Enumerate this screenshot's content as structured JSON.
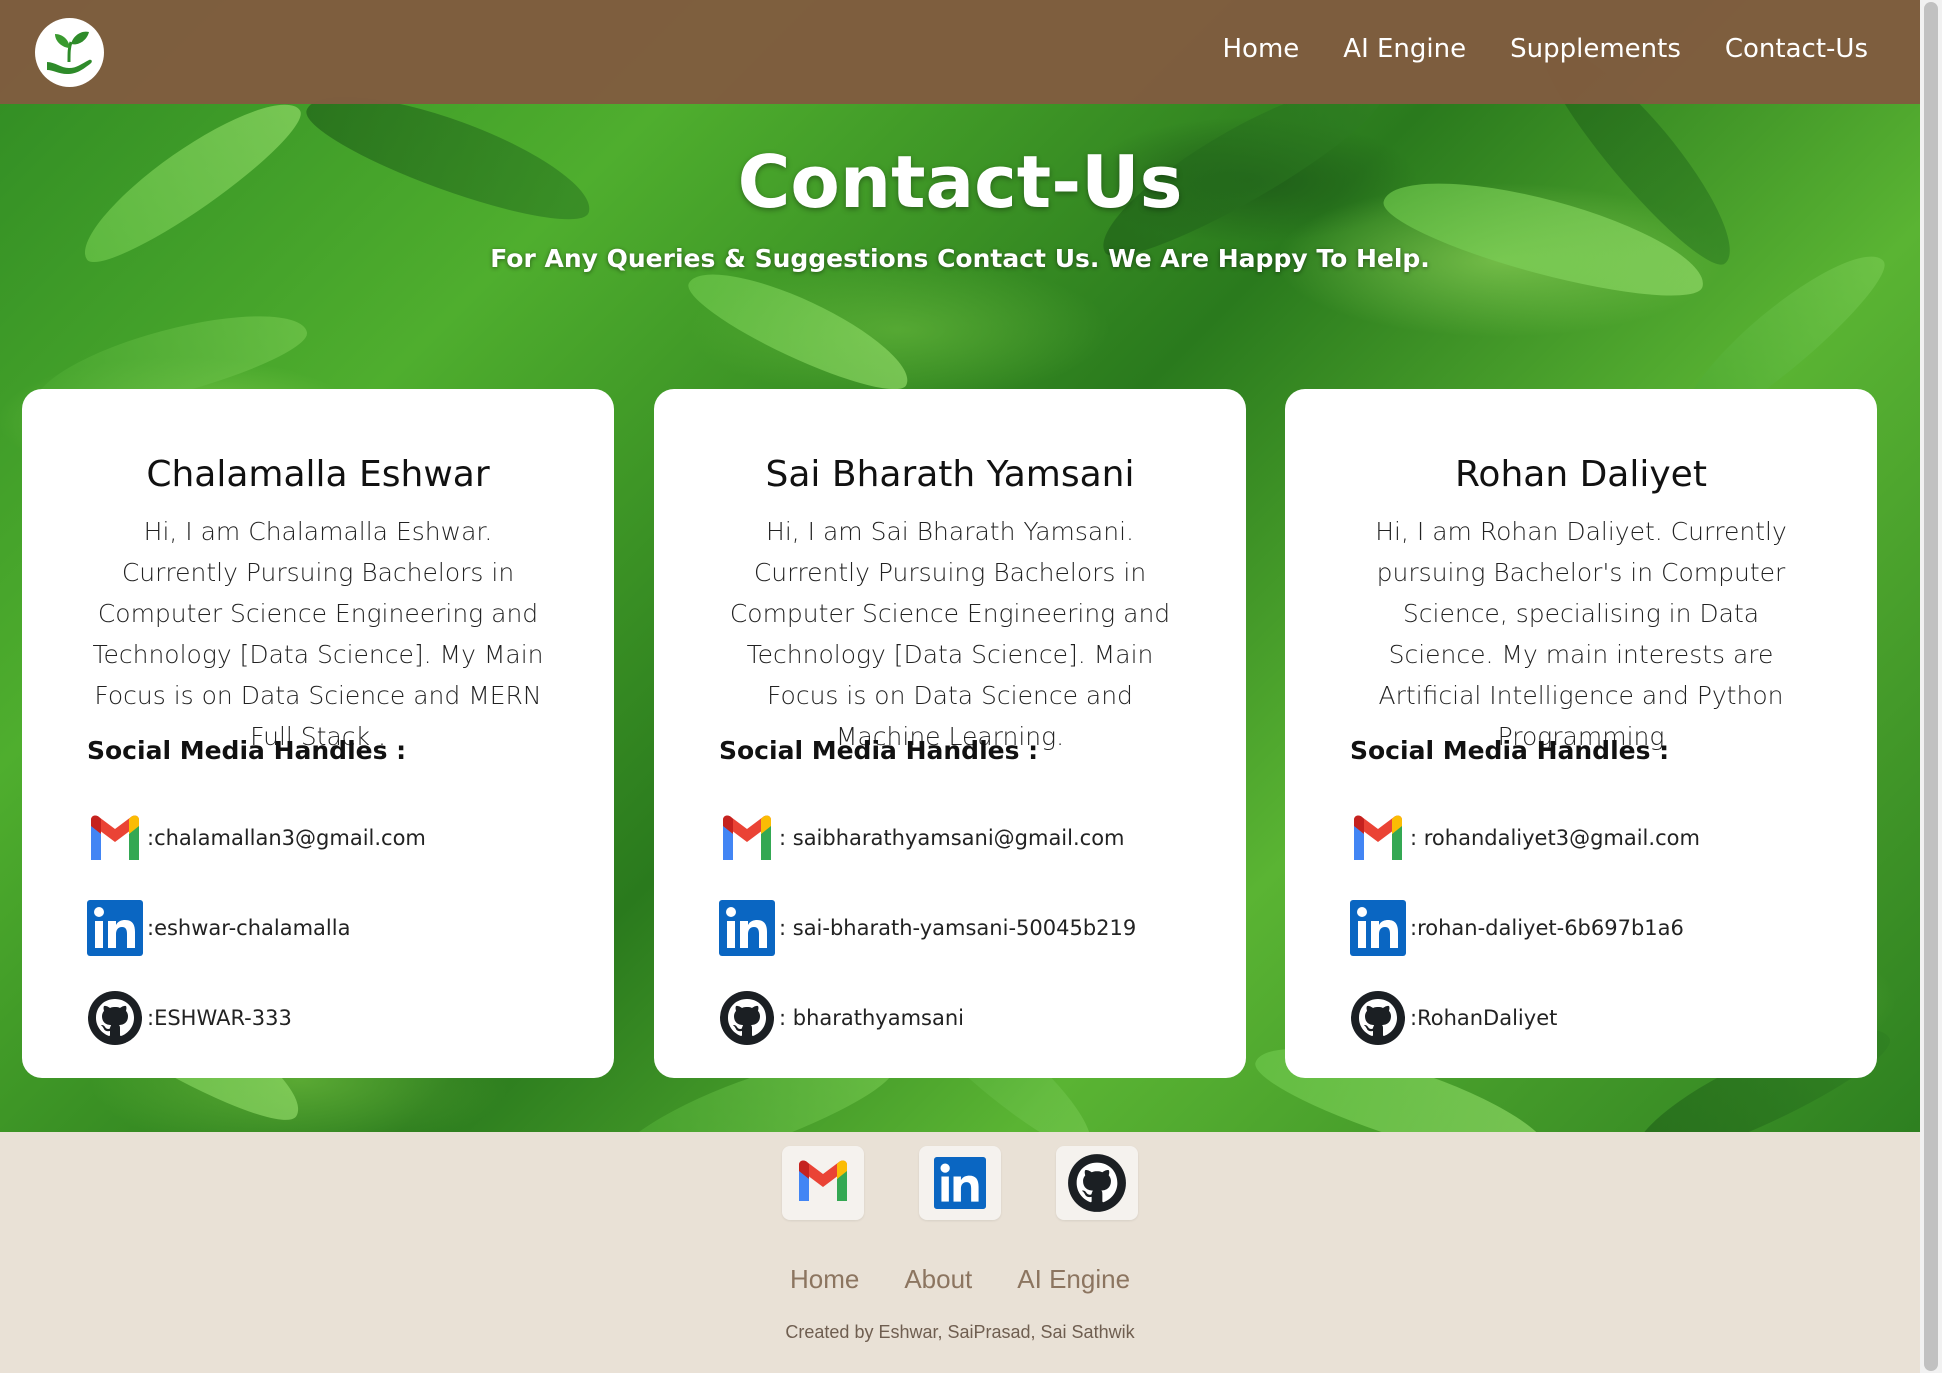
{
  "nav": {
    "logo_icon": "plant-in-hand-icon",
    "links": [
      "Home",
      "AI Engine",
      "Supplements",
      "Contact-Us"
    ]
  },
  "hero": {
    "title": "Contact-Us",
    "subtitle": "For Any Queries & Suggestions Contact Us. We Are Happy To Help."
  },
  "cards": [
    {
      "name": "Chalamalla Eshwar",
      "bio": "Hi, I am Chalamalla Eshwar. Currently Pursuing Bachelors in Computer Science Engineering and Technology [Data Science]. My Main Focus is on Data Science and MERN Full Stack .",
      "handles_title": "Social Media Handles :",
      "email": ":chalamallan3@gmail.com",
      "linkedin": ":eshwar-chalamalla",
      "github": ":ESHWAR-333"
    },
    {
      "name": "Sai Bharath Yamsani",
      "bio": "Hi, I am Sai Bharath Yamsani. Currently Pursuing Bachelors in Computer Science Engineering and Technology [Data Science]. Main Focus is on Data Science and Machine Learning.",
      "handles_title": "Social Media Handles :",
      "email": ": saibharathyamsani@gmail.com",
      "linkedin": " : sai-bharath-yamsani-50045b219",
      "github": ": bharathyamsani"
    },
    {
      "name": "Rohan Daliyet",
      "bio": "Hi, I am Rohan Daliyet. Currently pursuing Bachelor's in Computer Science, specialising in Data Science. My main interests are Artificial Intelligence and Python Programming",
      "handles_title": "Social Media Handles :",
      "email": ": rohandaliyet3@gmail.com",
      "linkedin": ":rohan-daliyet-6b697b1a6",
      "github": ":RohanDaliyet"
    }
  ],
  "footer": {
    "icons": [
      "gmail-icon",
      "linkedin-icon",
      "github-icon"
    ],
    "links": [
      "Home",
      "About",
      "AI Engine"
    ],
    "credit": "Created by Eshwar, SaiPrasad, Sai Sathwik"
  },
  "colors": {
    "navbar": "#805c3f",
    "footer_bg": "#e9e1d6",
    "footer_link": "#8c7560",
    "linkedin_blue": "#0a66c2",
    "github_black": "#1b1f23"
  }
}
